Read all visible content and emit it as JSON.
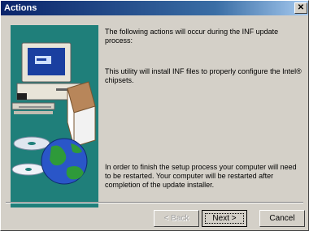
{
  "window": {
    "title": "Actions",
    "close_glyph": "✕"
  },
  "content": {
    "intro": "The following actions will occur during the INF update process:",
    "utility": "This utility will install INF files to properly configure the Intel® chipsets.",
    "restart": "In order to finish the setup process your computer will need to be restarted.  Your computer will be restarted after completion of the update installer."
  },
  "buttons": {
    "back": "< Back",
    "next": "Next >",
    "cancel": "Cancel"
  },
  "colors": {
    "titlebar_start": "#0a246a",
    "art_background": "#1f7f7a",
    "dialog_face": "#d4d0c8"
  },
  "icons": {
    "art": "computer-with-cd-and-globe",
    "close": "close-icon"
  }
}
